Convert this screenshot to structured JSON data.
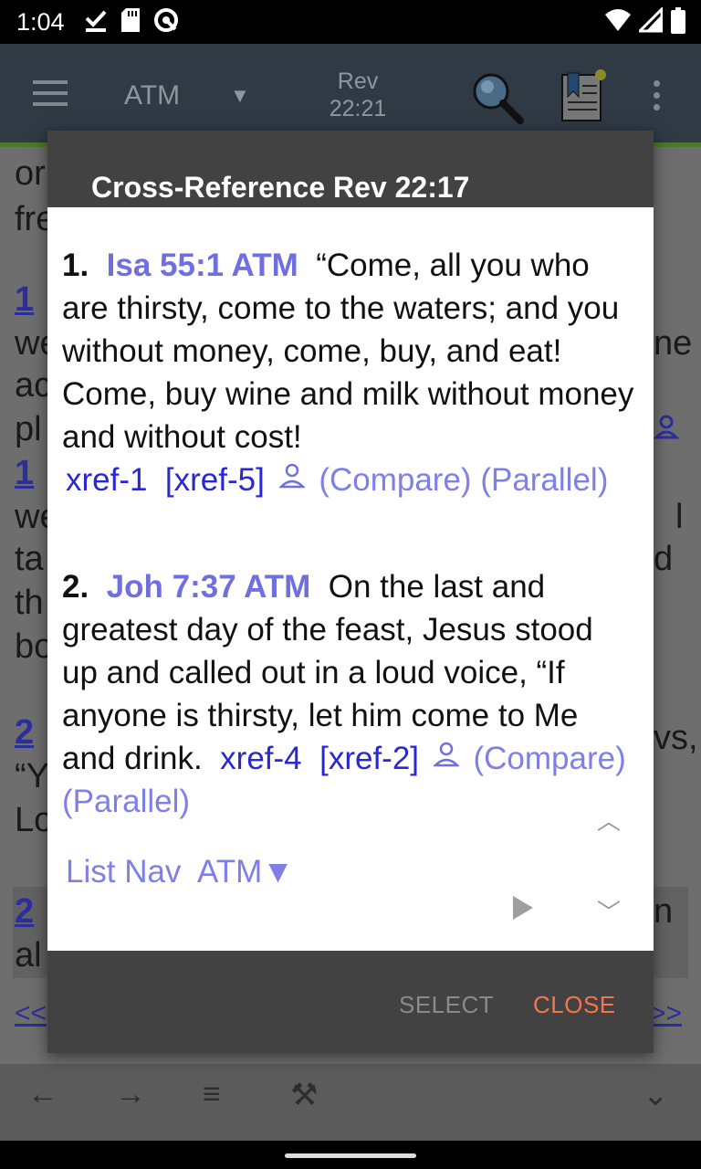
{
  "status_bar": {
    "time": "1:04"
  },
  "app_bar": {
    "version": "ATM",
    "reference_book": "Rev",
    "reference_verse": "22:21"
  },
  "background_text": {
    "frag1": "or",
    "frag2": "fre",
    "frag3": "1",
    "frag4": "we",
    "frag5": "ac",
    "frag6": "pl",
    "frag7": "1",
    "frag8": "we",
    "frag9": "ta",
    "frag10": "th",
    "frag11": "bo",
    "frag12": "2",
    "frag13": "“Y",
    "frag14": "Lo",
    "frag15": "2",
    "frag16": "al",
    "right1": "ne",
    "right2": "l",
    "right3": "d",
    "right4": "vs,",
    "right5": "n",
    "prev_link": "<<",
    "next_link": ">>"
  },
  "bottom_bar": {
    "back": "←",
    "forward": "→",
    "menu": "≡",
    "tools": "⚒",
    "expand": "⌄"
  },
  "dialog": {
    "title": "Cross-Reference Rev 22:17",
    "entries": [
      {
        "number": "1.",
        "verse_ref": "Isa 55:1 ATM",
        "text": "“Come, all you who are thirsty, come to the waters; and you without money, come, buy, and eat! Come, buy wine and milk without money and without cost!",
        "xref_a": "xref-1",
        "xref_b": "[xref-5]",
        "compare": "(Compare)",
        "parallel": "(Parallel)"
      },
      {
        "number": "2.",
        "verse_ref": "Joh 7:37 ATM",
        "text": "On the last and greatest day of the feast, Jesus stood up and called out in a loud voice, “If anyone is thirsty, let him come to Me and drink.",
        "xref_a": "xref-4",
        "xref_b": "[xref-2]",
        "compare": "(Compare)",
        "parallel": "(Parallel)"
      }
    ],
    "list_nav": "List Nav",
    "list_version": "ATM▼",
    "buttons": {
      "select": "SELECT",
      "close": "CLOSE"
    }
  }
}
